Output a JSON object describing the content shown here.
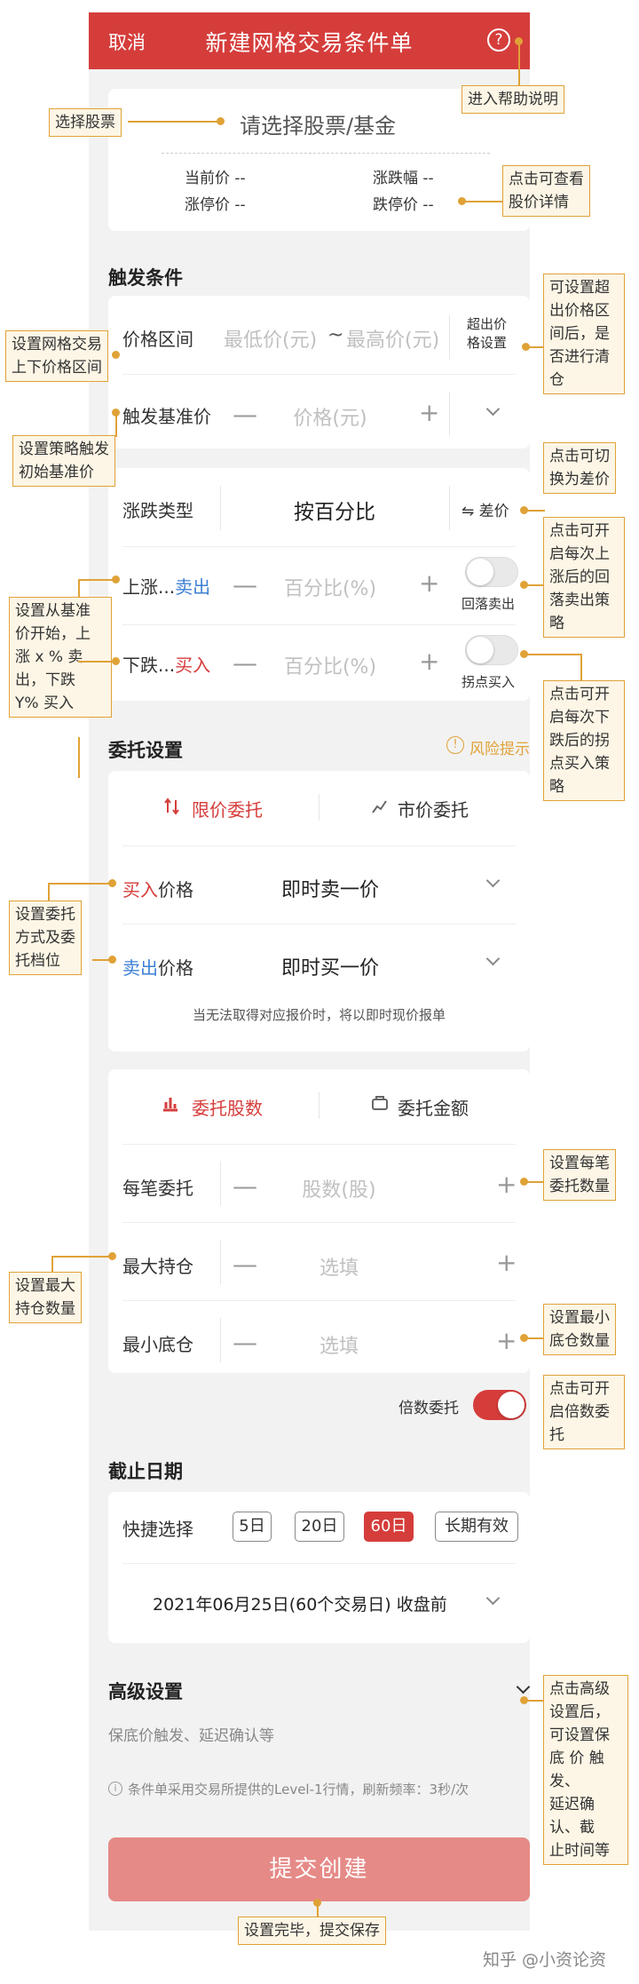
{
  "header": {
    "cancel_label": "取消",
    "title": "新建网格交易条件单",
    "help_icon_label": "?"
  },
  "stock": {
    "placeholder": "请选择股票/基金",
    "current_price_label": "当前价 --",
    "change_label": "涨跌幅 --",
    "limit_up_label": "涨停价 --",
    "limit_down_label": "跌停价 --"
  },
  "trigger": {
    "section_title": "触发条件",
    "price_range_label": "价格区间",
    "min_price_placeholder": "最低价(元)",
    "range_sep": "~",
    "max_price_placeholder": "最高价(元)",
    "out_of_range_label_1": "超出价",
    "out_of_range_label_2": "格设置",
    "base_price_label": "触发基准价",
    "base_price_placeholder": "价格(元)",
    "minus": "—",
    "plus": "+",
    "change_type_label": "涨跌类型",
    "change_type_value": "按百分比",
    "switch_diff_label": "⇋ 差价",
    "rise_label_prefix": "上涨...",
    "rise_label_action": "卖出",
    "rise_placeholder": "百分比(%)",
    "rise_toggle_label": "回落卖出",
    "fall_label_prefix": "下跌...",
    "fall_label_action": "买入",
    "fall_placeholder": "百分比(%)",
    "fall_toggle_label": "拐点买入"
  },
  "order": {
    "section_title": "委托设置",
    "risk_label": "风险提示",
    "tab_limit": "限价委托",
    "tab_market": "市价委托",
    "buy_price_label_action": "买入",
    "buy_price_label_rest": "价格",
    "buy_price_value": "即时卖一价",
    "sell_price_label_action": "卖出",
    "sell_price_label_rest": "价格",
    "sell_price_value": "即时买一价",
    "fallback_note": "当无法取得对应报价时，将以即时现价报单",
    "tab_shares": "委托股数",
    "tab_amount": "委托金额",
    "per_order_label": "每笔委托",
    "per_order_placeholder": "股数(股)",
    "max_position_label": "最大持仓",
    "max_position_placeholder": "选填",
    "min_position_label": "最小底仓",
    "min_position_placeholder": "选填",
    "multiple_label": "倍数委托"
  },
  "deadline": {
    "section_title": "截止日期",
    "quick_label": "快捷选择",
    "chips": [
      "5日",
      "20日",
      "60日",
      "长期有效"
    ],
    "selected_chip": "60日",
    "date_value": "2021年06月25日(60个交易日) 收盘前"
  },
  "advanced": {
    "title": "高级设置",
    "subtitle": "保底价触发、延迟确认等",
    "footnote": "条件单采用交易所提供的Level-1行情，刷新频率：3秒/次"
  },
  "submit_label": "提交创建",
  "annotations": {
    "select_stock": "选择股票",
    "help": "进入帮助说明",
    "detail_1": "点击可查看",
    "detail_2": "股价详情",
    "grid_range_1": "设置网格交易",
    "grid_range_2": "上下价格区间",
    "out_range_1": "可设置超",
    "out_range_2": "出价格区",
    "out_range_3": "间后，是",
    "out_range_4": "否进行清",
    "out_range_5": "仓",
    "base_price_1": "设置策略触发",
    "base_price_2": "初始基准价",
    "switch_diff_1": "点击可切",
    "switch_diff_2": "换为差价",
    "rise_toggle_1": "点击可开",
    "rise_toggle_2": "启每次上",
    "rise_toggle_3": "涨后的回",
    "rise_toggle_4": "落卖出策",
    "rise_toggle_5": "略",
    "pct_1": "设置从基准",
    "pct_2": "价开始，上",
    "pct_3": "涨 x % 卖",
    "pct_4": "出，下跌",
    "pct_5": "Y% 买入",
    "fall_toggle_1": "点击可开",
    "fall_toggle_2": "启每次下",
    "fall_toggle_3": "跌后的拐",
    "fall_toggle_4": "点买入策",
    "fall_toggle_5": "略",
    "order_method_1": "设置委托",
    "order_method_2": "方式及委",
    "order_method_3": "托档位",
    "per_order_1": "设置每笔",
    "per_order_2": "委托数量",
    "max_pos_1": "设置最大",
    "max_pos_2": "持仓数量",
    "min_pos_1": "设置最小",
    "min_pos_2": "底仓数量",
    "multiple_1": "点击可开",
    "multiple_2": "启倍数委",
    "multiple_3": "托",
    "advanced_1": "点击高级",
    "advanced_2": "设置后，",
    "advanced_3": "可设置保",
    "advanced_4": "底 价 触发、",
    "advanced_5": "延迟确认、截",
    "advanced_6": "止时间等",
    "submit_note": "设置完毕，提交保存"
  },
  "watermark": "知乎 @小资论资",
  "colors": {
    "brand_red": "#d53d3b",
    "submit_disabled": "#e58a87",
    "annotation_border": "#e0a237",
    "annotation_fill": "#fdf6e6",
    "link_blue": "#3d7fd5"
  }
}
